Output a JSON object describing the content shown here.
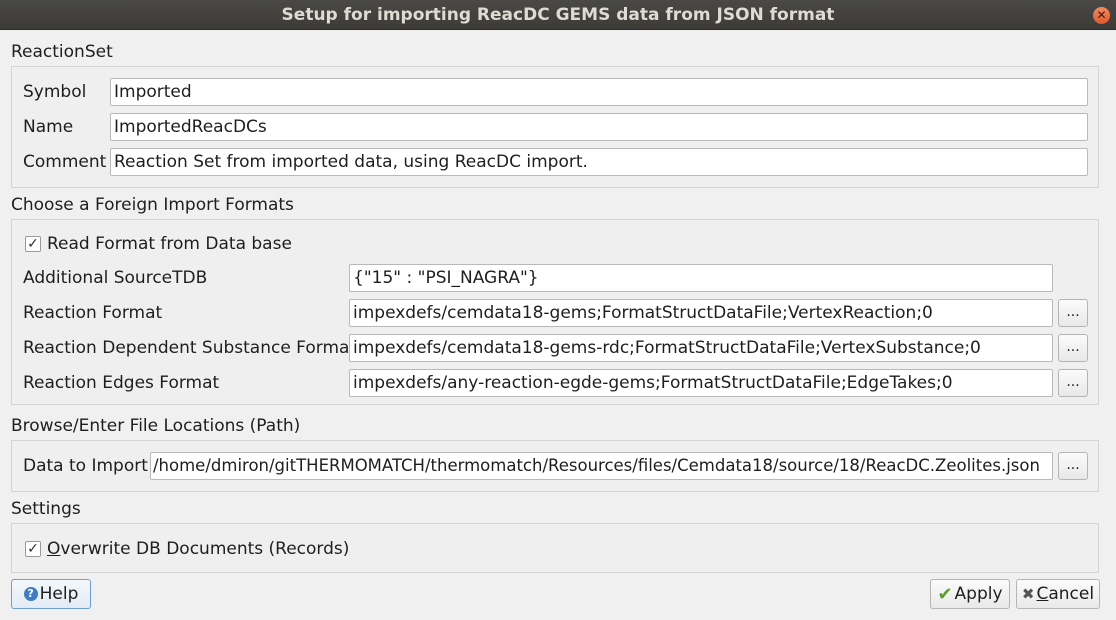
{
  "window": {
    "title": "Setup for importing ReacDC GEMS data from JSON format",
    "close_glyph": "✕"
  },
  "reaction_set": {
    "section_title": "ReactionSet",
    "symbol_label": "Symbol",
    "symbol_value": "Imported",
    "name_label": "Name",
    "name_value": "ImportedReacDCs",
    "comment_label": "Comment",
    "comment_value": "Reaction Set from imported data, using ReacDC import."
  },
  "formats": {
    "section_title": "Choose a  Foreign Import Formats",
    "read_format_checked": true,
    "read_format_label": "Read Format from Data base",
    "source_tdb_label": "Additional SourceTDB",
    "source_tdb_value": "{\"15\" : \"PSI_NAGRA\"}",
    "reaction_format_label": "Reaction Format",
    "reaction_format_value": "impexdefs/cemdata18-gems;FormatStructDataFile;VertexReaction;0",
    "dep_substance_label": "Reaction Dependent Substance Format",
    "dep_substance_value": "impexdefs/cemdata18-gems-rdc;FormatStructDataFile;VertexSubstance;0",
    "edges_label": "Reaction Edges Format",
    "edges_value": "impexdefs/any-reaction-egde-gems;FormatStructDataFile;EdgeTakes;0",
    "browse_label": "..."
  },
  "files": {
    "section_title": "Browse/Enter File Locations (Path)",
    "data_label": "Data to Import",
    "data_value": "/home/dmiron/gitTHERMOMATCH/thermomatch/Resources/files/Cemdata18/source/18/ReacDC.Zeolites.json",
    "browse_label": "..."
  },
  "settings": {
    "section_title": "Settings",
    "overwrite_checked": true,
    "overwrite_first": "O",
    "overwrite_rest": "verwrite DB Documents (Records)"
  },
  "buttons": {
    "help_label": "Help",
    "apply_label": "Apply",
    "cancel_first": "C",
    "cancel_rest": "ancel"
  },
  "icons": {
    "check": "✓",
    "help": "?",
    "apply": "✔",
    "cancel": "✖"
  }
}
